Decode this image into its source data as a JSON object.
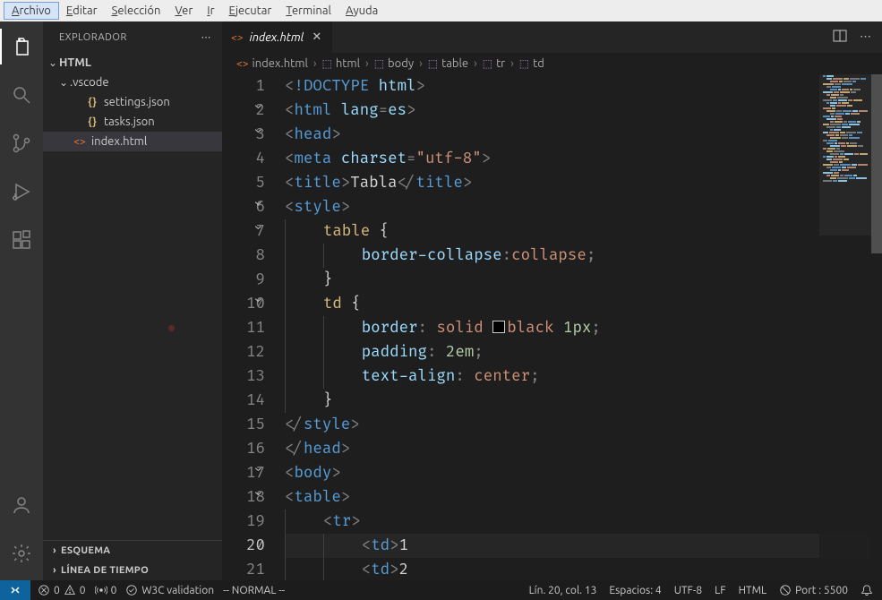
{
  "menubar": {
    "items": [
      {
        "label": "Archivo",
        "mnemonic": "A",
        "active": true
      },
      {
        "label": "Editar",
        "mnemonic": "E"
      },
      {
        "label": "Selección",
        "mnemonic": "S"
      },
      {
        "label": "Ver",
        "mnemonic": "V"
      },
      {
        "label": "Ir",
        "mnemonic": "I"
      },
      {
        "label": "Ejecutar",
        "mnemonic": "E"
      },
      {
        "label": "Terminal",
        "mnemonic": "T"
      },
      {
        "label": "Ayuda",
        "mnemonic": "A"
      }
    ]
  },
  "sidebar": {
    "title": "EXPLORADOR",
    "root": "HTML",
    "folder_vscode": ".vscode",
    "file_settings": "settings.json",
    "file_tasks": "tasks.json",
    "file_index": "index.html",
    "section_outline": "ESQUEMA",
    "section_timeline": "LÍNEA DE TIEMPO"
  },
  "tabs": {
    "active_filename": "index.html"
  },
  "breadcrumbs": {
    "items": [
      "index.html",
      "html",
      "body",
      "table",
      "tr",
      "td"
    ]
  },
  "editor": {
    "current_line": 20,
    "breakpoint_line": 11,
    "lines": [
      {
        "n": 1,
        "fold": false,
        "tokens": [
          [
            "punc",
            "<"
          ],
          [
            "bang",
            "!"
          ],
          [
            "doctype",
            "DOCTYPE"
          ],
          [
            "text",
            " "
          ],
          [
            "attr",
            "html"
          ],
          [
            "punc",
            ">"
          ]
        ]
      },
      {
        "n": 2,
        "fold": true,
        "tokens": [
          [
            "punc",
            "<"
          ],
          [
            "tag",
            "html"
          ],
          [
            "text",
            " "
          ],
          [
            "attr",
            "lang"
          ],
          [
            "punc",
            "="
          ],
          [
            "attr",
            "es"
          ],
          [
            "punc",
            ">"
          ]
        ]
      },
      {
        "n": 3,
        "fold": true,
        "tokens": [
          [
            "punc",
            "<"
          ],
          [
            "tag",
            "head"
          ],
          [
            "punc",
            ">"
          ]
        ]
      },
      {
        "n": 4,
        "fold": false,
        "tokens": [
          [
            "punc",
            "<"
          ],
          [
            "tag",
            "meta"
          ],
          [
            "text",
            " "
          ],
          [
            "attr",
            "charset"
          ],
          [
            "punc",
            "="
          ],
          [
            "str",
            "\"utf-8\""
          ],
          [
            "punc",
            ">"
          ]
        ]
      },
      {
        "n": 5,
        "fold": false,
        "tokens": [
          [
            "punc",
            "<"
          ],
          [
            "tag",
            "title"
          ],
          [
            "punc",
            ">"
          ],
          [
            "text",
            "Tabla"
          ],
          [
            "punc",
            "</"
          ],
          [
            "tag",
            "title"
          ],
          [
            "punc",
            ">"
          ]
        ]
      },
      {
        "n": 6,
        "fold": true,
        "tokens": [
          [
            "punc",
            "<"
          ],
          [
            "tag",
            "style"
          ],
          [
            "punc",
            ">"
          ]
        ]
      },
      {
        "n": 7,
        "fold": true,
        "indent": 1,
        "tokens": [
          [
            "sel",
            "table"
          ],
          [
            "text",
            " "
          ],
          [
            "keybrace",
            "{"
          ]
        ]
      },
      {
        "n": 8,
        "fold": false,
        "indent": 2,
        "tokens": [
          [
            "prop",
            "border-collapse"
          ],
          [
            "punc",
            ":"
          ],
          [
            "val",
            "collapse"
          ],
          [
            "punc",
            ";"
          ]
        ]
      },
      {
        "n": 9,
        "fold": false,
        "indent": 1,
        "tokens": [
          [
            "keybrace",
            "}"
          ]
        ]
      },
      {
        "n": 10,
        "fold": true,
        "indent": 1,
        "tokens": [
          [
            "sel",
            "td"
          ],
          [
            "text",
            " "
          ],
          [
            "keybrace",
            "{"
          ]
        ]
      },
      {
        "n": 11,
        "fold": false,
        "indent": 2,
        "tokens": [
          [
            "prop",
            "border"
          ],
          [
            "punc",
            ": "
          ],
          [
            "val",
            "solid"
          ],
          [
            "text",
            " "
          ],
          [
            "swatch",
            ""
          ],
          [
            "val",
            "black"
          ],
          [
            "text",
            " "
          ],
          [
            "num",
            "1px"
          ],
          [
            "punc",
            ";"
          ]
        ]
      },
      {
        "n": 12,
        "fold": false,
        "indent": 2,
        "tokens": [
          [
            "prop",
            "padding"
          ],
          [
            "punc",
            ": "
          ],
          [
            "num",
            "2em"
          ],
          [
            "punc",
            ";"
          ]
        ]
      },
      {
        "n": 13,
        "fold": false,
        "indent": 2,
        "tokens": [
          [
            "prop",
            "text-align"
          ],
          [
            "punc",
            ": "
          ],
          [
            "val",
            "center"
          ],
          [
            "punc",
            ";"
          ]
        ]
      },
      {
        "n": 14,
        "fold": false,
        "indent": 1,
        "tokens": [
          [
            "keybrace",
            "}"
          ]
        ]
      },
      {
        "n": 15,
        "fold": false,
        "tokens": [
          [
            "punc",
            "</"
          ],
          [
            "tag",
            "style"
          ],
          [
            "punc",
            ">"
          ]
        ]
      },
      {
        "n": 16,
        "fold": false,
        "tokens": [
          [
            "punc",
            "</"
          ],
          [
            "tag",
            "head"
          ],
          [
            "punc",
            ">"
          ]
        ]
      },
      {
        "n": 17,
        "fold": true,
        "tokens": [
          [
            "punc",
            "<"
          ],
          [
            "tag",
            "body"
          ],
          [
            "punc",
            ">"
          ]
        ]
      },
      {
        "n": 18,
        "fold": true,
        "tokens": [
          [
            "punc",
            "<"
          ],
          [
            "tag",
            "table"
          ],
          [
            "punc",
            ">"
          ]
        ]
      },
      {
        "n": 19,
        "fold": false,
        "indent": 1,
        "tokens": [
          [
            "punc",
            "<"
          ],
          [
            "tag",
            "tr"
          ],
          [
            "punc",
            ">"
          ]
        ]
      },
      {
        "n": 20,
        "fold": false,
        "indent": 2,
        "tokens": [
          [
            "punc",
            "<"
          ],
          [
            "tag",
            "td"
          ],
          [
            "punc",
            ">"
          ],
          [
            "text",
            "1"
          ]
        ]
      },
      {
        "n": 21,
        "fold": false,
        "indent": 2,
        "tokens": [
          [
            "punc",
            "<"
          ],
          [
            "tag",
            "td"
          ],
          [
            "punc",
            ">"
          ],
          [
            "text",
            "2"
          ]
        ]
      }
    ]
  },
  "statusbar": {
    "errors": "0",
    "warnings": "0",
    "radio": "0",
    "w3c": "W3C validation",
    "vim_mode": "-- NORMAL --",
    "position": "Lín. 20, col. 13",
    "spaces": "Espacios: 4",
    "encoding": "UTF-8",
    "eol": "LF",
    "language": "HTML",
    "port": "Port : 5500"
  }
}
